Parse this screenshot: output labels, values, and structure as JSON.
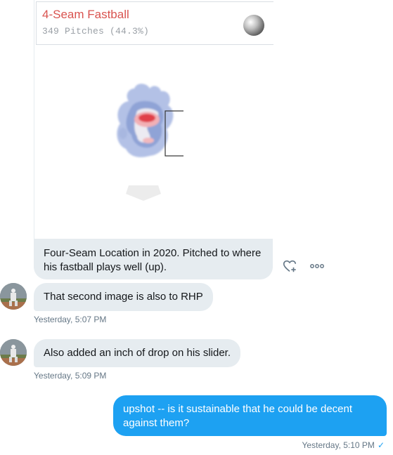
{
  "card": {
    "title": "4-Seam Fastball",
    "subtitle": "349 Pitches (44.3%)",
    "caption": "Four-Seam Location in 2020. Pitched to where his fastball plays well (up)."
  },
  "messages": [
    {
      "text": "That second image is also to RHP",
      "time": "Yesterday, 5:07 PM"
    },
    {
      "text": "Also added an inch of drop on his slider.",
      "time": "Yesterday, 5:09 PM"
    }
  ],
  "outgoing": {
    "text": "upshot -- is it sustainable that he could be decent against them?",
    "time": "Yesterday, 5:10 PM",
    "status_icon": "check-icon"
  },
  "colors": {
    "title_red": "#d9534f",
    "bubble_gray": "#e6ecf0",
    "accent_blue": "#1da1f2",
    "heat_blue": "#8fa3d6",
    "heat_red": "#e0404a"
  }
}
